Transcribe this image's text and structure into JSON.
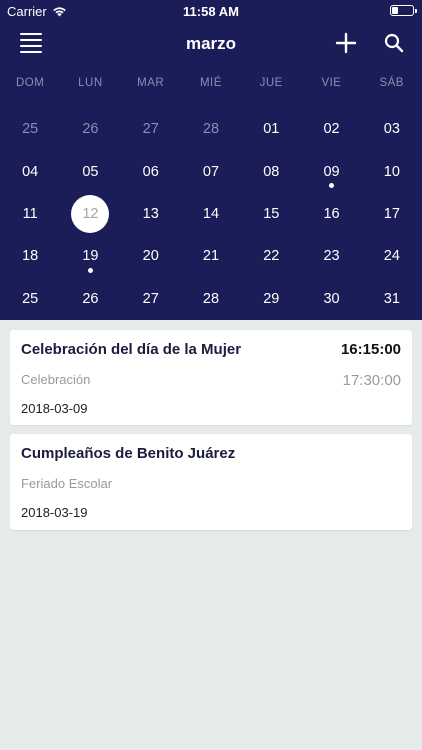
{
  "status_bar": {
    "carrier": "Carrier",
    "time": "11:58 AM",
    "battery_level": 0.3
  },
  "nav": {
    "title": "marzo",
    "menu_icon": "hamburger-menu-icon",
    "add_icon": "plus-icon",
    "search_icon": "magnifier-icon"
  },
  "calendar": {
    "weekdays": [
      "DOM",
      "LUN",
      "MAR",
      "MIÉ",
      "JUE",
      "VIE",
      "SÁB"
    ],
    "weeks": [
      [
        {
          "d": "25",
          "muted": true
        },
        {
          "d": "26",
          "muted": true
        },
        {
          "d": "27",
          "muted": true
        },
        {
          "d": "28",
          "muted": true
        },
        {
          "d": "01"
        },
        {
          "d": "02"
        },
        {
          "d": "03"
        }
      ],
      [
        {
          "d": "04"
        },
        {
          "d": "05"
        },
        {
          "d": "06"
        },
        {
          "d": "07"
        },
        {
          "d": "08"
        },
        {
          "d": "09",
          "dot": true
        },
        {
          "d": "10"
        }
      ],
      [
        {
          "d": "11"
        },
        {
          "d": "12",
          "selected": true
        },
        {
          "d": "13"
        },
        {
          "d": "14"
        },
        {
          "d": "15"
        },
        {
          "d": "16"
        },
        {
          "d": "17"
        }
      ],
      [
        {
          "d": "18"
        },
        {
          "d": "19",
          "dot": true
        },
        {
          "d": "20"
        },
        {
          "d": "21"
        },
        {
          "d": "22"
        },
        {
          "d": "23"
        },
        {
          "d": "24"
        }
      ],
      [
        {
          "d": "25"
        },
        {
          "d": "26"
        },
        {
          "d": "27"
        },
        {
          "d": "28"
        },
        {
          "d": "29"
        },
        {
          "d": "30"
        },
        {
          "d": "31"
        }
      ]
    ]
  },
  "events": [
    {
      "title": "Celebración del día de la Mujer",
      "start": "16:15:00",
      "end": "17:30:00",
      "type": "Celebración",
      "date": "2018-03-09"
    },
    {
      "title": "Cumpleaños de Benito Juárez",
      "type": "Feriado Escolar",
      "date": "2018-03-19"
    }
  ],
  "colors": {
    "header_bg": "#1b1d58",
    "page_bg": "#e6eaea",
    "muted_day": "#8a8db3"
  }
}
